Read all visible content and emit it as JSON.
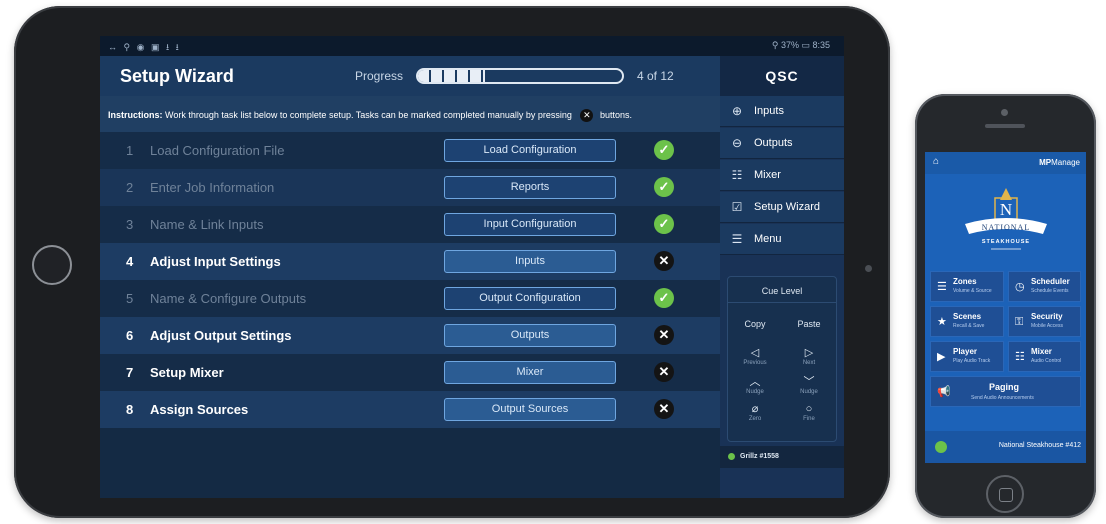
{
  "ipad": {
    "status_bar": {
      "left_icons": "↔ ⚲ ◉ ▣ ⭳ ⭳",
      "right": "⚲ 37% ▭ 8:35"
    },
    "wizard": {
      "title": "Setup Wizard",
      "progress_label": "Progress",
      "progress_fraction": 0.33,
      "progress_count": "4 of 12"
    },
    "instructions": {
      "bold": "Instructions:",
      "text": "Work through task list below to complete setup. Tasks can be marked completed manually by pressing",
      "suffix": "buttons."
    },
    "tasks": [
      {
        "num": "1",
        "name": "Load Configuration File",
        "button": "Load Configuration",
        "status": "check"
      },
      {
        "num": "2",
        "name": "Enter Job Information",
        "button": "Reports",
        "status": "check"
      },
      {
        "num": "3",
        "name": "Name & Link Inputs",
        "button": "Input Configuration",
        "status": "check"
      },
      {
        "num": "4",
        "name": "Adjust Input Settings",
        "button": "Inputs",
        "status": "x"
      },
      {
        "num": "5",
        "name": "Name & Configure Outputs",
        "button": "Output Configuration",
        "status": "check"
      },
      {
        "num": "6",
        "name": "Adjust Output Settings",
        "button": "Outputs",
        "status": "x"
      },
      {
        "num": "7",
        "name": "Setup Mixer",
        "button": "Mixer",
        "status": "x"
      },
      {
        "num": "8",
        "name": "Assign Sources",
        "button": "Output Sources",
        "status": "x"
      }
    ],
    "side": {
      "brand": "QSC",
      "nav": [
        {
          "label": "Inputs",
          "icon": "input-icon"
        },
        {
          "label": "Outputs",
          "icon": "output-icon"
        },
        {
          "label": "Mixer",
          "icon": "mixer-icon"
        },
        {
          "label": "Setup Wizard",
          "icon": "checklist-icon"
        },
        {
          "label": "Menu",
          "icon": "menu-icon"
        }
      ],
      "cue": {
        "title": "Cue Level",
        "copy": "Copy",
        "paste": "Paste",
        "previous": "Previous",
        "next": "Next",
        "nudge_up": "Nudge",
        "nudge_down": "Nudge",
        "zero": "Zero",
        "fine": "Fine"
      },
      "venue": "Grillz #1558"
    }
  },
  "iphone": {
    "brand_bold": "MP",
    "brand_rest": "Manage",
    "logo": {
      "letter": "N",
      "ribbon": "NATIONAL",
      "sub": "STEAKHOUSE"
    },
    "tiles": [
      {
        "title": "Zones",
        "sub": "Volume & Source",
        "icon": "zones-icon"
      },
      {
        "title": "Scheduler",
        "sub": "Schedule Events",
        "icon": "clock-icon"
      },
      {
        "title": "Scenes",
        "sub": "Recall & Save",
        "icon": "star-icon"
      },
      {
        "title": "Security",
        "sub": "Mobile Access",
        "icon": "key-icon"
      },
      {
        "title": "Player",
        "sub": "Play Audio Track",
        "icon": "play-icon"
      },
      {
        "title": "Mixer",
        "sub": "Audio Control",
        "icon": "mixer-icon"
      },
      {
        "title": "Paging",
        "sub": "Send Audio Announcements",
        "icon": "megaphone-icon"
      }
    ],
    "footer": "National Steakhouse #412"
  },
  "colors": {
    "check": "#6cc24a",
    "x": "#141414",
    "accent_button_border": "#6fa6e0",
    "screen_bg": "#142a44",
    "phone_bg": "#1c62b8"
  }
}
